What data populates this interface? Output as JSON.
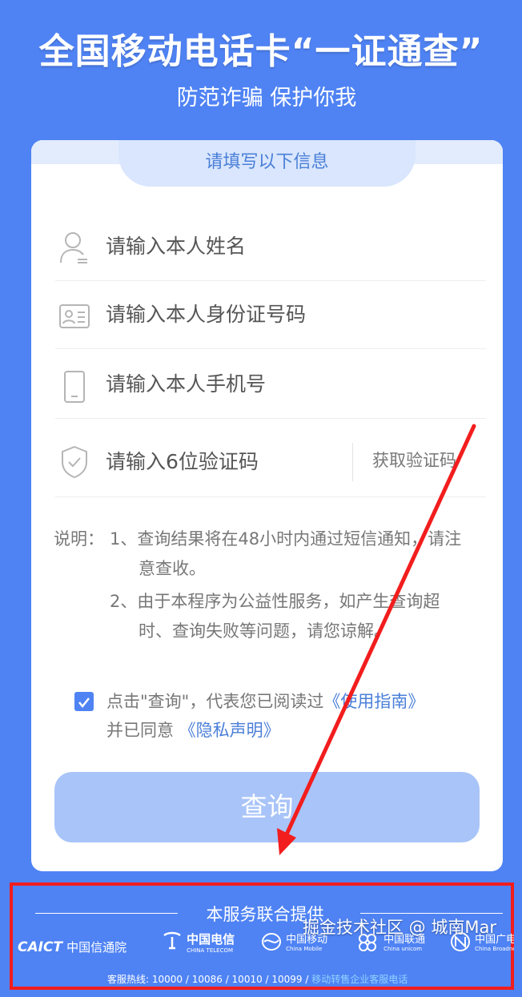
{
  "header": {
    "title": "全国移动电话卡“一证通查”",
    "subtitle": "防范诈骗 保护你我"
  },
  "form": {
    "tab_title": "请填写以下信息",
    "fields": [
      {
        "placeholder": "请输入本人姓名",
        "icon": "user-icon"
      },
      {
        "placeholder": "请输入本人身份证号码",
        "icon": "id-card-icon"
      },
      {
        "placeholder": "请输入本人手机号",
        "icon": "phone-icon"
      },
      {
        "placeholder": "请输入6位验证码",
        "icon": "shield-check-icon"
      }
    ],
    "get_code_label": "获取验证码"
  },
  "notes": {
    "label": "说明：",
    "item1_line1": "1、查询结果将在48小时内通过短信通知，请注",
    "item1_line2": "意查收。",
    "item2_line1": "2、由于本程序为公益性服务，如产生查询超",
    "item2_line2": "时、查询失败等问题，请您谅解。"
  },
  "agreement": {
    "checked": true,
    "text1": "点击\"查询\"，代表您已阅读过",
    "link1": "《使用指南》",
    "text2": "并已同意",
    "link2": "《隐私声明》"
  },
  "query_button": "查询",
  "providers": {
    "title": "本服务联合提供",
    "logos": [
      {
        "name": "CAICT",
        "label": "中国信通院"
      },
      {
        "name": "中国电信",
        "label": "CHINA TELECOM"
      },
      {
        "name": "中国移动",
        "label": "China Mobile"
      },
      {
        "name": "中国联通",
        "label": "China unicom"
      },
      {
        "name": "中国广电",
        "label": "China Broadnet"
      }
    ],
    "hotline_prefix": "客服热线: 10000 / 10086 / 10010 / 10099 /",
    "hotline_link": "移动转售企业客服电话"
  },
  "watermark": "掘金技术社区 @ 城南Mar",
  "colors": {
    "background": "#4f83f4",
    "accent": "#4a7fd8",
    "button_disabled": "#a8c4f8",
    "annotation_red": "#f21d1d"
  }
}
